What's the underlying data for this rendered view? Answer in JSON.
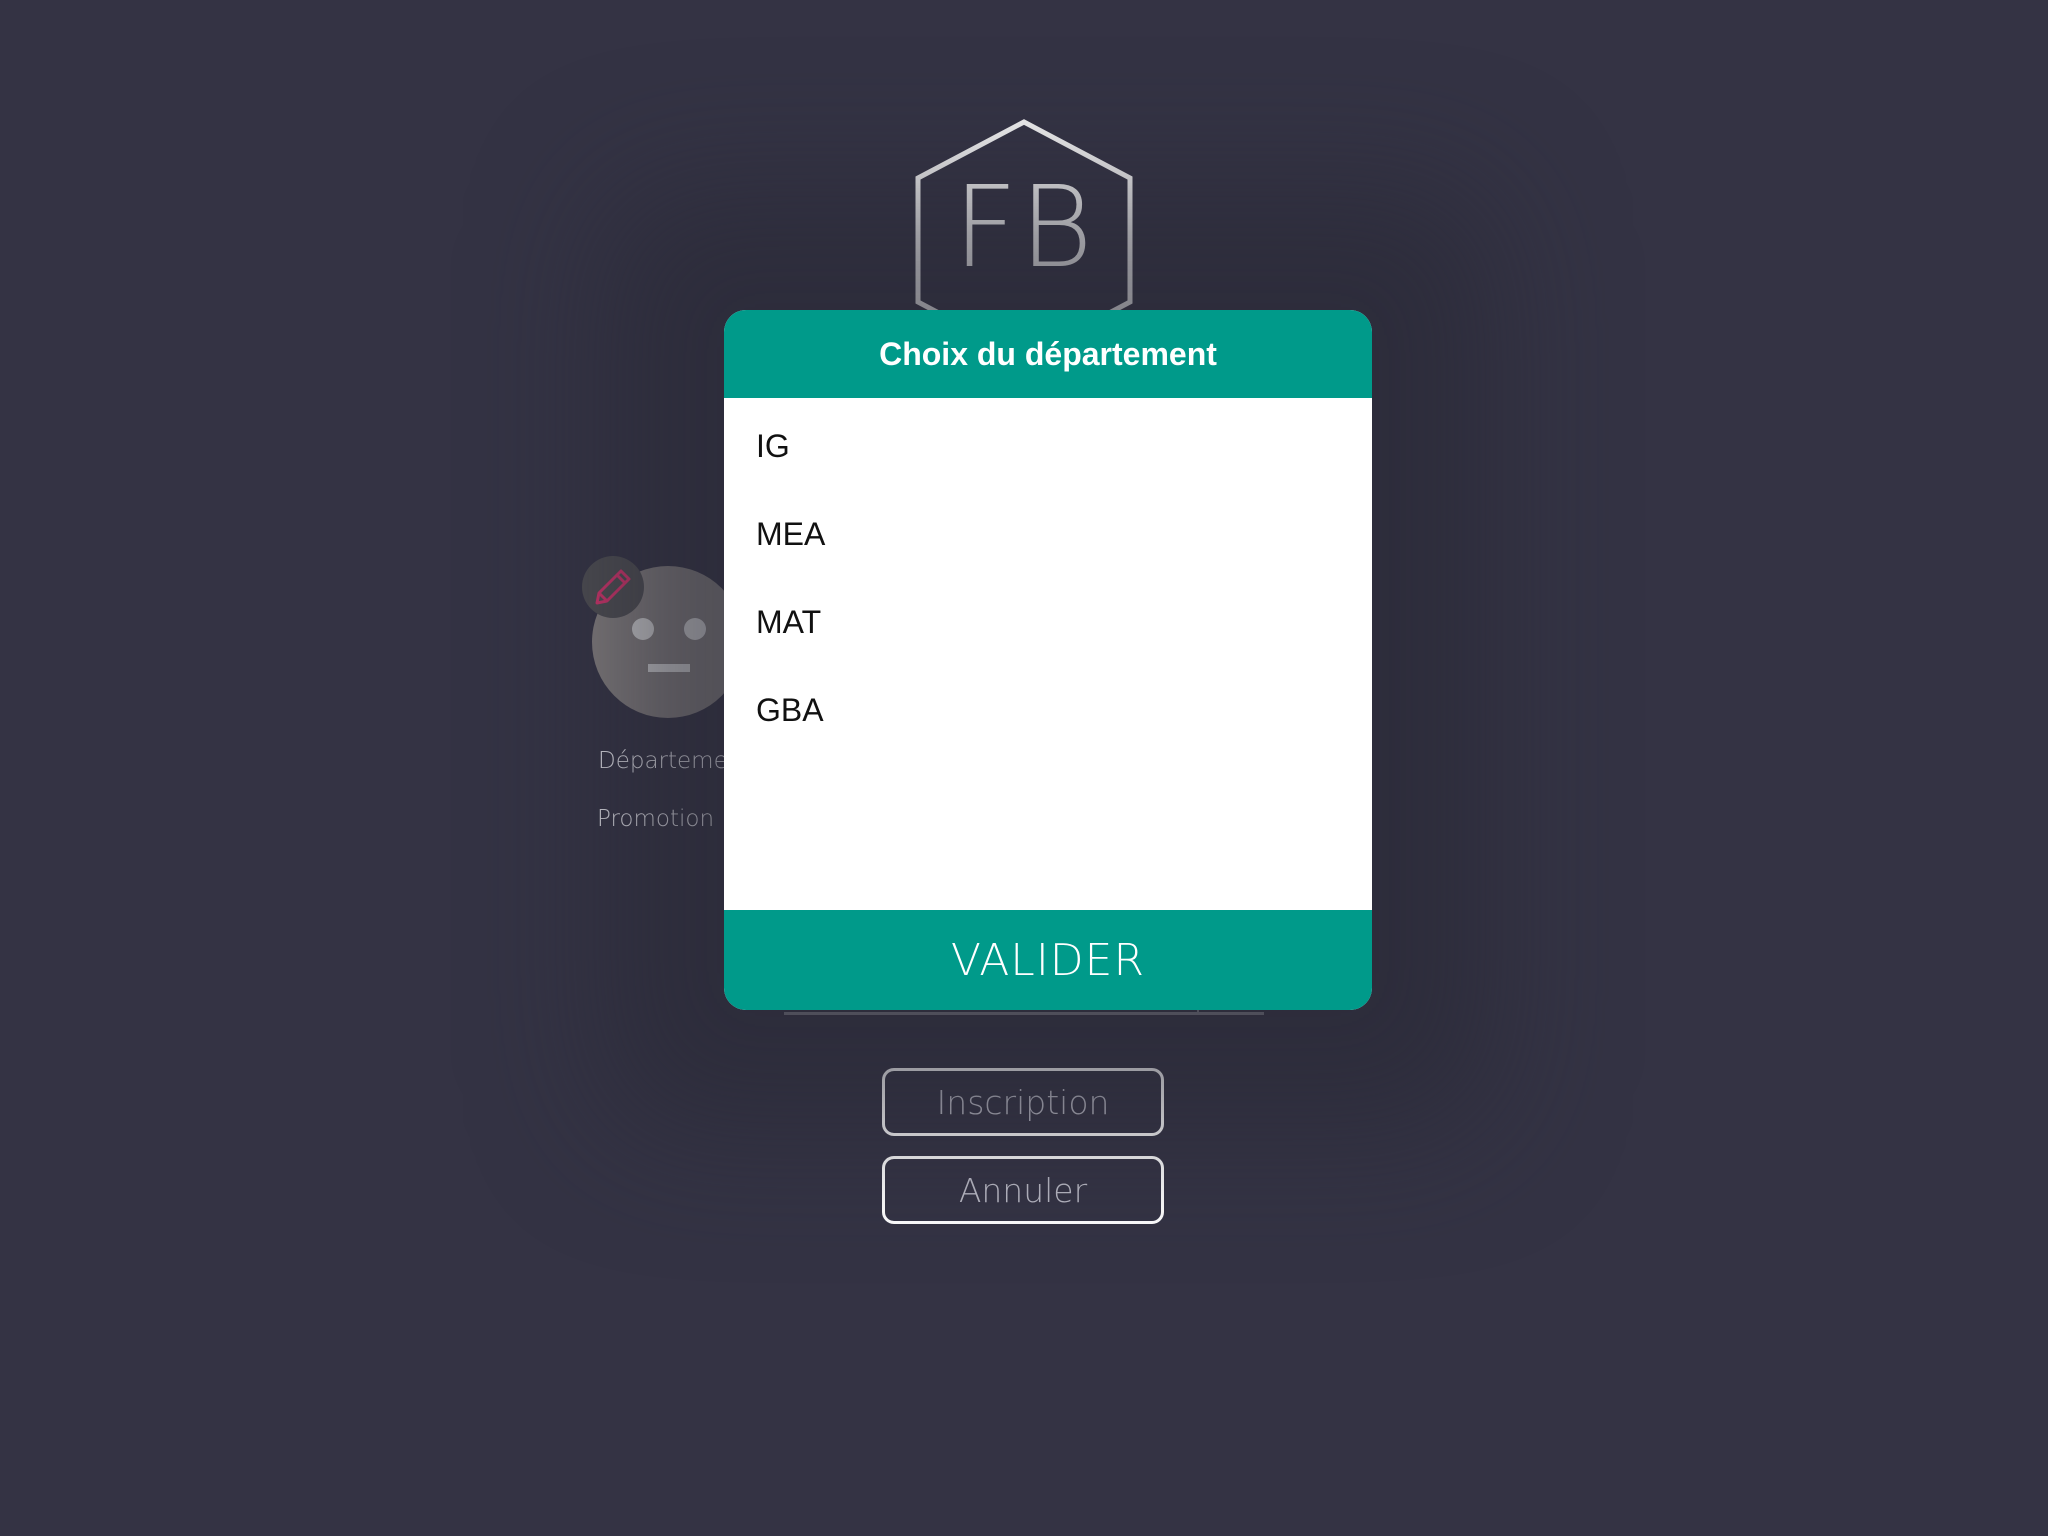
{
  "logo": {
    "text": "FB",
    "icon": "hexagon-logo-icon"
  },
  "profile": {
    "avatar_icon": "neutral-face-icon",
    "edit_icon": "pencil-icon",
    "edit_icon_color": "#d6336c"
  },
  "fields": {
    "departement_label": "Département",
    "promotion_label": "Promotion"
  },
  "buttons": {
    "inscription": "Inscription",
    "annuler": "Annuler"
  },
  "dialog": {
    "title": "Choix du département",
    "options": [
      "IG",
      "MEA",
      "MAT",
      "GBA"
    ],
    "confirm": "VALIDER",
    "accent_color": "#009a8a"
  }
}
